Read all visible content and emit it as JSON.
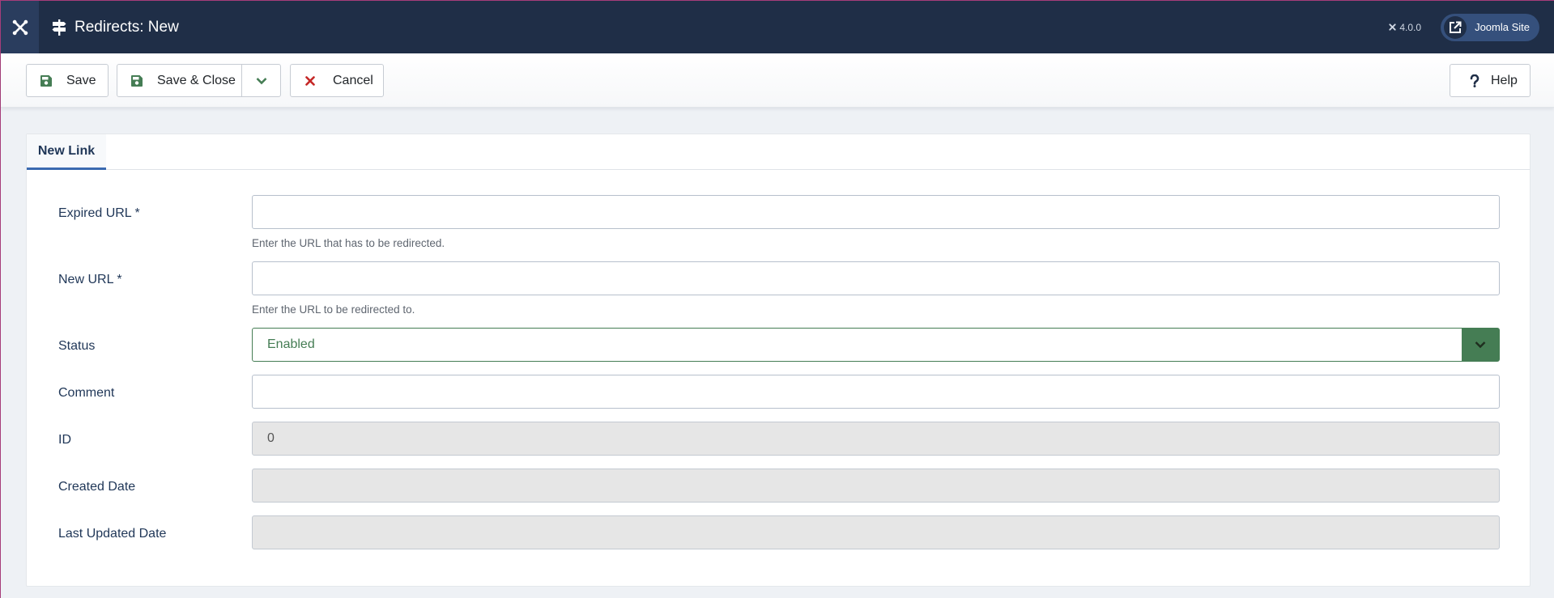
{
  "header": {
    "title": "Redirects: New",
    "version": "4.0.0",
    "site_link": "Joomla Site"
  },
  "toolbar": {
    "save_label": "Save",
    "save_close_label": "Save & Close",
    "cancel_label": "Cancel",
    "help_label": "Help"
  },
  "tabs": [
    {
      "label": "New Link",
      "active": true
    }
  ],
  "form": {
    "expired_url": {
      "label": "Expired URL *",
      "value": "",
      "hint": "Enter the URL that has to be redirected."
    },
    "new_url": {
      "label": "New URL *",
      "value": "",
      "hint": "Enter the URL to be redirected to."
    },
    "status": {
      "label": "Status",
      "value": "Enabled"
    },
    "comment": {
      "label": "Comment",
      "value": ""
    },
    "id": {
      "label": "ID",
      "value": "0"
    },
    "created_date": {
      "label": "Created Date",
      "value": ""
    },
    "last_updated_date": {
      "label": "Last Updated Date",
      "value": ""
    }
  },
  "colors": {
    "header_bg": "#1f2e47",
    "accent_blue": "#3b6ab0",
    "status_green": "#457d54",
    "cancel_red": "#c52827"
  }
}
